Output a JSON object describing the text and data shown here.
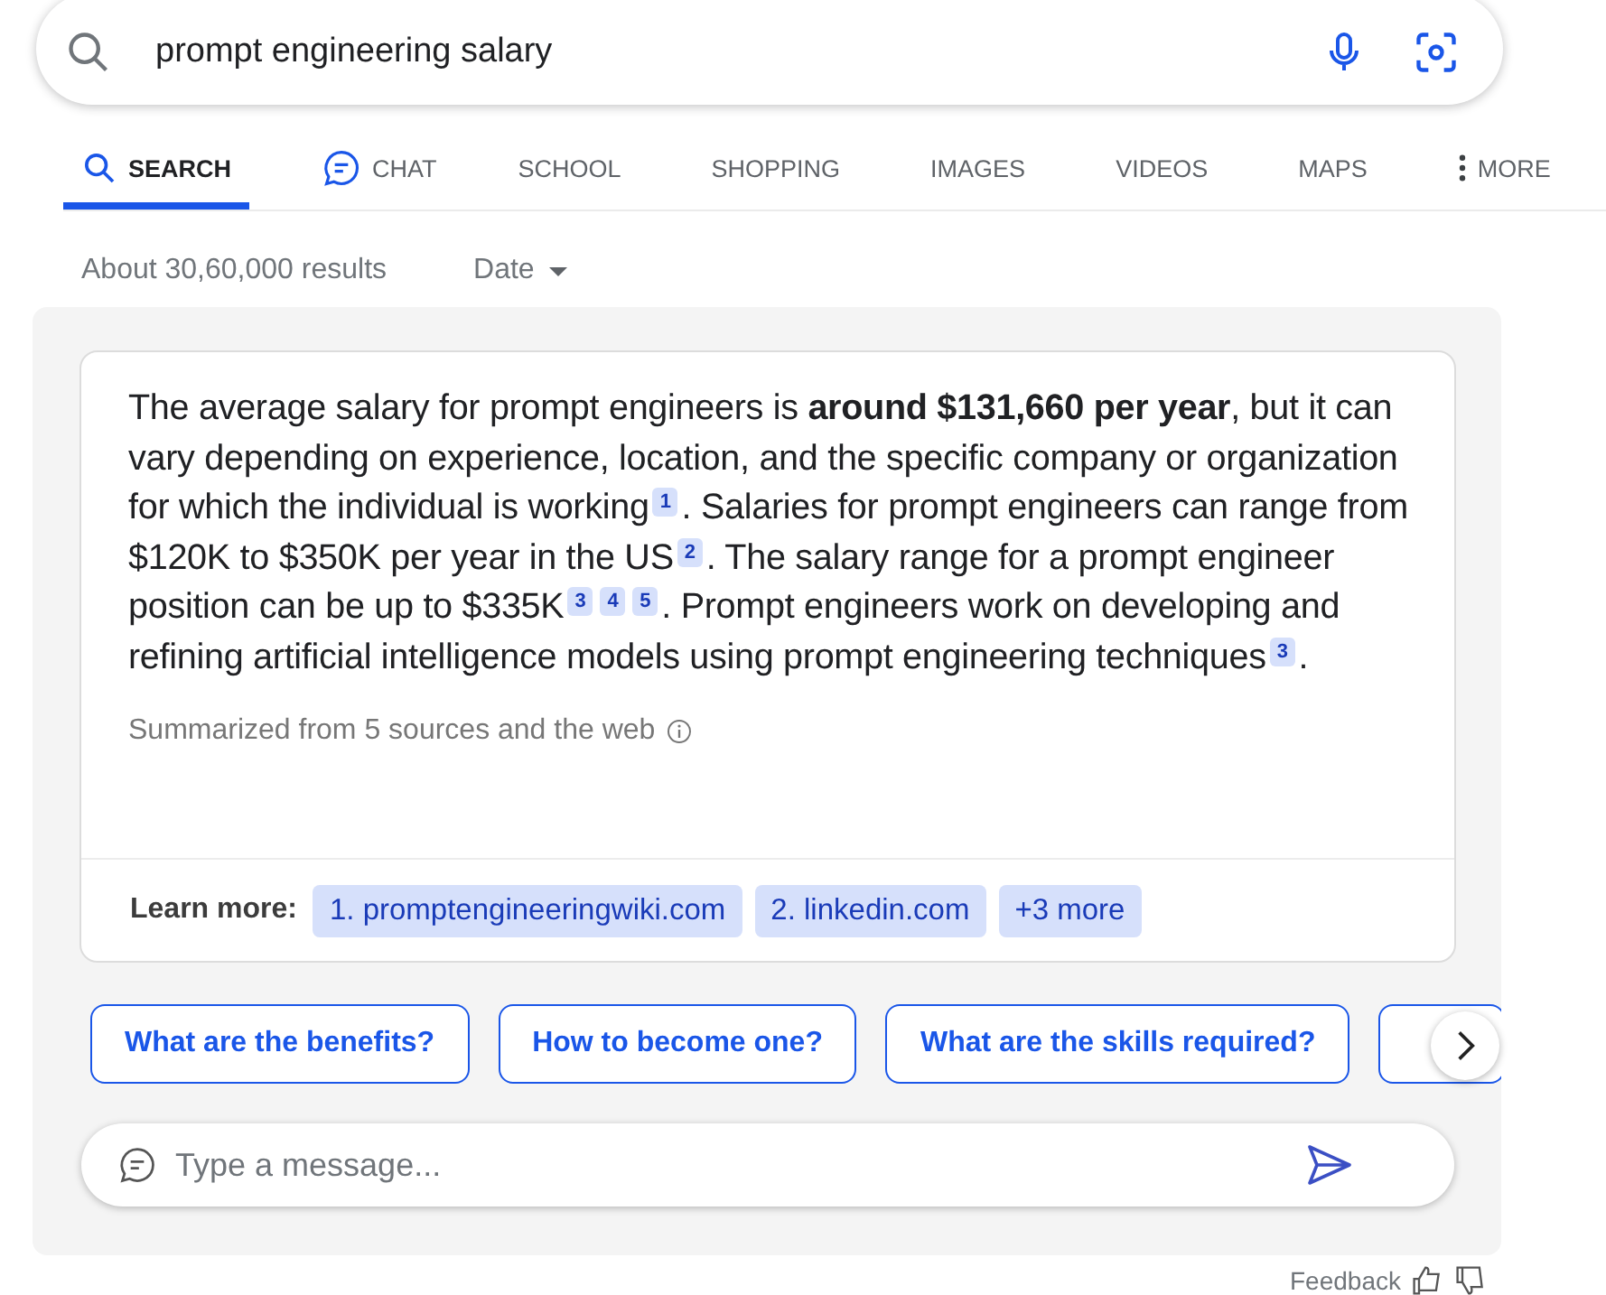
{
  "search": {
    "value": "prompt engineering salary"
  },
  "tabs": [
    {
      "label": "SEARCH",
      "kind": "search",
      "selected": true
    },
    {
      "label": "CHAT",
      "kind": "chat",
      "selected": false
    },
    {
      "label": "SCHOOL",
      "kind": "plain",
      "selected": false
    },
    {
      "label": "SHOPPING",
      "kind": "plain",
      "selected": false
    },
    {
      "label": "IMAGES",
      "kind": "plain",
      "selected": false
    },
    {
      "label": "VIDEOS",
      "kind": "plain",
      "selected": false
    },
    {
      "label": "MAPS",
      "kind": "plain",
      "selected": false
    },
    {
      "label": "MORE",
      "kind": "more",
      "selected": false
    }
  ],
  "results_count": "About 30,60,000 results",
  "date_filter": "Date",
  "answer": {
    "segments": [
      {
        "kind": "text",
        "text": "The average salary for prompt engineers is **around $131,660 per year**, but it can vary depending on experience, location, and the specific company or organization for which the individual is working"
      },
      {
        "kind": "cite",
        "text": "1"
      },
      {
        "kind": "text",
        "text": ". Salaries for prompt engineers can range from $120K to $350K per year in the US"
      },
      {
        "kind": "cite",
        "text": "2"
      },
      {
        "kind": "text",
        "text": ". The salary range for a prompt engineer position can be up to $335K"
      },
      {
        "kind": "cite",
        "text": "3"
      },
      {
        "kind": "cite",
        "text": "4"
      },
      {
        "kind": "cite",
        "text": "5"
      },
      {
        "kind": "text",
        "text": ". Prompt engineers work on developing and refining artificial intelligence models using prompt engineering techniques"
      },
      {
        "kind": "cite",
        "text": "3"
      },
      {
        "kind": "text",
        "text": "."
      }
    ],
    "summary": "Summarized from 5 sources and the web",
    "learn_more_label": "Learn more:",
    "learn_more_links": [
      "1. promptengineeringwiki.com",
      "2. linkedin.com",
      "+3 more"
    ]
  },
  "suggestions": [
    "What are the benefits?",
    "How to become one?",
    "What are the skills required?"
  ],
  "message": {
    "placeholder": "Type a message..."
  },
  "feedback": "Feedback"
}
